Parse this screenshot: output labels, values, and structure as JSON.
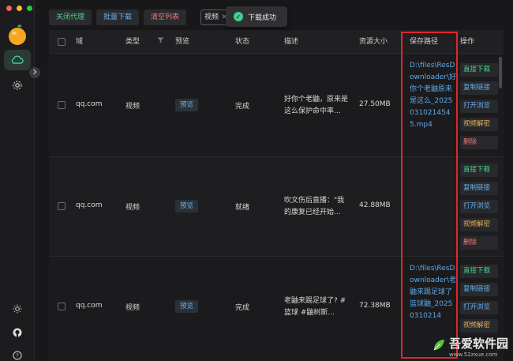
{
  "toolbar": {
    "proxy_label": "关闭代理",
    "batch_label": "批量下载",
    "clear_label": "清空列表",
    "filter_value": "视频",
    "filter_clear": "✕"
  },
  "toast": {
    "text": "下载成功"
  },
  "table": {
    "headers": {
      "domain": "域",
      "type": "类型",
      "preview": "预览",
      "status": "状态",
      "desc": "描述",
      "size": "资源大小",
      "path": "保存路径",
      "ops": "操作"
    },
    "rows": [
      {
        "domain": "qq.com",
        "type": "视频",
        "preview": "预览",
        "status": "完成",
        "desc": "好你个老鼬，原来是这么保护命中率...",
        "size": "27.50MB",
        "path": "D:\\files\\ResDownloader\\好你个老鼬原来是这么_20250310214545.mp4",
        "ops": [
          "直接下载",
          "复制链接",
          "打开浏览",
          "视频解密",
          "删除"
        ]
      },
      {
        "domain": "qq.com",
        "type": "视频",
        "preview": "预览",
        "status": "就绪",
        "desc": "吹文伤后直播：\"我的康复已经开始...",
        "size": "42.88MB",
        "path": "",
        "ops": [
          "直接下载",
          "复制链接",
          "打开浏览",
          "视频解密",
          "删除"
        ]
      },
      {
        "domain": "qq.com",
        "type": "视频",
        "preview": "预览",
        "status": "完成",
        "desc": "老鼬来踢足球了? #篮球 #鼬树斯...",
        "size": "72.38MB",
        "path": "D:\\files\\ResDownloader\\老鼬来踢足球了篮球鼬_20250310214",
        "ops": [
          "直接下载",
          "复制链接",
          "打开浏览",
          "视频解密"
        ]
      }
    ]
  },
  "watermark": {
    "title": "吾爱软件园",
    "url": "www.52zxue.com"
  },
  "colors": {
    "accent_green": "#4fd08a",
    "link_blue": "#6ab0f0",
    "danger_red": "#f07a7a",
    "highlight_box": "#e0262a"
  }
}
